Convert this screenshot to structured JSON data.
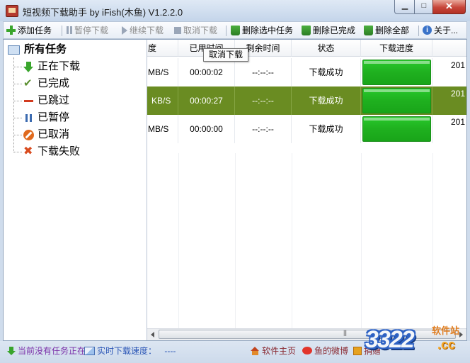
{
  "window": {
    "title": "短视频下载助手 by iFish(木鱼) V1.2.2.0",
    "min_icon": "minimize-icon",
    "max_icon": "maximize-icon",
    "close_icon": "close-icon"
  },
  "toolbar": {
    "add": "添加任务",
    "pause": "暂停下载",
    "resume": "继续下载",
    "cancel": "取消下载",
    "delete_selected": "删除选中任务",
    "delete_completed": "删除已完成",
    "delete_all": "删除全部",
    "about": "关于..."
  },
  "tree": {
    "root": "所有任务",
    "items": [
      {
        "label": "正在下载",
        "icon": "download-arrow-icon"
      },
      {
        "label": "已完成",
        "icon": "checkmark-icon"
      },
      {
        "label": "已跳过",
        "icon": "dash-icon"
      },
      {
        "label": "已暂停",
        "icon": "pause-icon"
      },
      {
        "label": "已取消",
        "icon": "cancel-icon"
      },
      {
        "label": "下载失败",
        "icon": "x-icon"
      }
    ]
  },
  "table": {
    "columns": [
      "度",
      "已用时间",
      "剩余时间",
      "状态",
      "下载进度"
    ],
    "rows": [
      {
        "speed": "MB/S",
        "elapsed": "00:00:02",
        "remaining": "--:--:--",
        "status": "下载成功",
        "progress": 1.0,
        "date": "201",
        "selected": false
      },
      {
        "speed": "KB/S",
        "elapsed": "00:00:27",
        "remaining": "--:--:--",
        "status": "下载成功",
        "progress": 1.0,
        "date": "201",
        "selected": true
      },
      {
        "speed": "MB/S",
        "elapsed": "00:00:00",
        "remaining": "--:--:--",
        "status": "下载成功",
        "progress": 1.0,
        "date": "201",
        "selected": false
      }
    ]
  },
  "tooltip": "取消下载",
  "status": {
    "task_text": "当前没有任务正在",
    "speed_label": "实时下载速度：",
    "speed_value": "----",
    "home": "软件主页",
    "weibo": "鱼的微博",
    "donate": "捐赠"
  },
  "watermark": {
    "site": "3322",
    "cc": ".cc",
    "label": "软件站"
  }
}
